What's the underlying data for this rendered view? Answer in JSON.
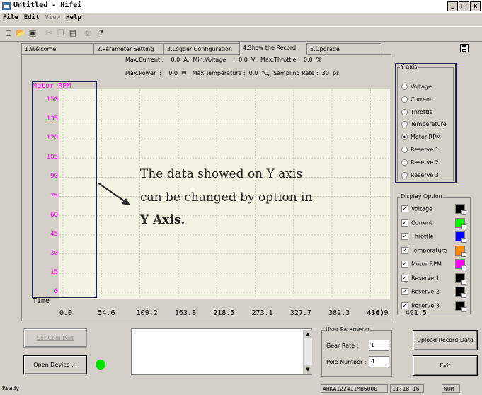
{
  "window": {
    "title": "Untitled - Hifei",
    "controls": [
      "_",
      "□",
      "x"
    ]
  },
  "menu": [
    {
      "label": "File",
      "enabled": true
    },
    {
      "label": "Edit",
      "enabled": true
    },
    {
      "label": "View",
      "enabled": false
    },
    {
      "label": "Help",
      "enabled": true
    }
  ],
  "toolbar": [
    "new-icon",
    "open-icon",
    "save-icon",
    "cut-icon",
    "copy-icon",
    "paste-icon",
    "print-icon",
    "help-icon"
  ],
  "tabs": [
    "1.Welcome",
    "2.Parameter Setting",
    "3.Logger Configuration",
    "4.Show the Record",
    "5.Upgrade"
  ],
  "active_tab": 3,
  "stats": {
    "line1": "Max.Current :    0.0  A,  Min.Voltage    :  0.0  V,  Max.Throttle :  0.0  %",
    "line2": "Max.Power  :    0.0  W,  Max.Temperature :  0.0  ℃,  Sampling Rate :  30  ps"
  },
  "chart_data": {
    "type": "line",
    "ylabel": "Motor RPM",
    "xlabel": "Time",
    "y_ticks": [
      "150",
      "135",
      "120",
      "105",
      "90",
      "75",
      "60",
      "45",
      "30",
      "15",
      "0"
    ],
    "x_ticks": [
      "0.0",
      "54.6",
      "109.2",
      "163.8",
      "218.5",
      "273.1",
      "327.7",
      "382.3",
      "436.9",
      "491.5"
    ],
    "x_unit": "(s)",
    "ylim": [
      0,
      150
    ],
    "grid": true,
    "series": []
  },
  "annotation": {
    "line1": "The data showed on Y axis",
    "line2": "can be changed by option in",
    "line3": "Y Axis."
  },
  "y_axis_group": {
    "label": "Y axis",
    "options": [
      "Voltage",
      "Current",
      "Throttle",
      "Temperature",
      "Motor RPM",
      "Reserve 1",
      "Reserve 2",
      "Reserve 3"
    ],
    "selected": 4
  },
  "display_group": {
    "label": "Display Option",
    "items": [
      {
        "label": "Voltage",
        "checked": true,
        "color": "#000000"
      },
      {
        "label": "Current",
        "checked": true,
        "color": "#00ff00"
      },
      {
        "label": "Throttle",
        "checked": true,
        "color": "#0000ff"
      },
      {
        "label": "Temperature",
        "checked": true,
        "color": "#ff8c00"
      },
      {
        "label": "Motor RPM",
        "checked": true,
        "color": "#ff00ff"
      },
      {
        "label": "Reserve 1",
        "checked": true,
        "color": "#000000"
      },
      {
        "label": "Reserve 2",
        "checked": true,
        "color": "#000000"
      },
      {
        "label": "Reserve 3",
        "checked": true,
        "color": "#000000"
      }
    ]
  },
  "buttons": {
    "set_com_port": "Set Com Port",
    "open_device": "Open Device ...",
    "upload_record": "Upload Record Data",
    "exit": "Exit"
  },
  "device_status_color": "#00e000",
  "user_parameter": {
    "label": "User Parameter",
    "gear_rate_label": "Gear Rate :",
    "gear_rate_value": "1",
    "pole_number_label": "Pole Number :",
    "pole_number_value": "4"
  },
  "statusbar": {
    "text": "Ready",
    "serial": "AHKA122411MB6000",
    "time": "11:18:16",
    "num": "NUM"
  }
}
